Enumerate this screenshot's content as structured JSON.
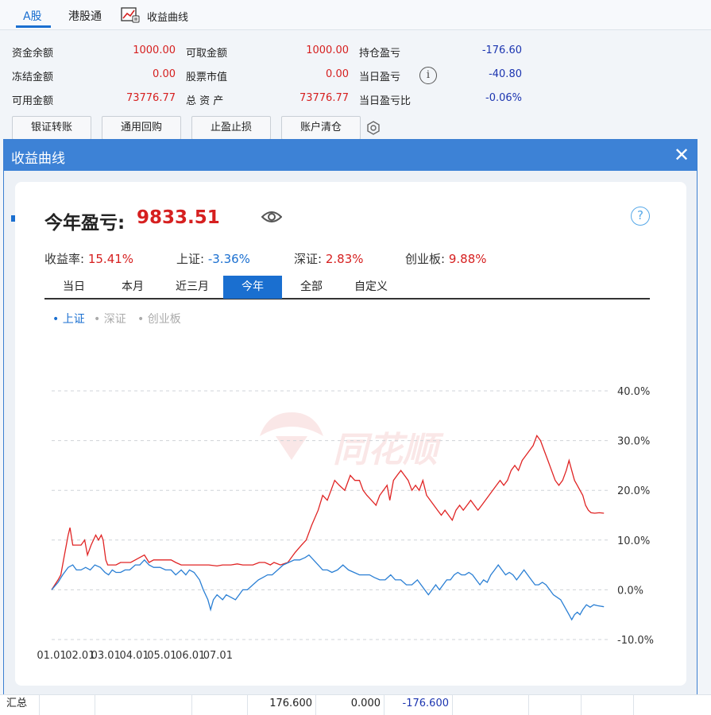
{
  "top_tabs": [
    {
      "label": "A股",
      "active": true
    },
    {
      "label": "港股通",
      "active": false
    },
    {
      "label": "收益曲线",
      "icon": "line-chart-icon",
      "active": false
    }
  ],
  "account": {
    "fund_balance_label": "资金余额",
    "fund_balance": "1000.00",
    "frozen_label": "冻结金额",
    "frozen": "0.00",
    "available_label": "可用金额",
    "available": "73776.77",
    "withdrawable_label": "可取金额",
    "withdrawable": "1000.00",
    "stock_value_label": "股票市值",
    "stock_value": "0.00",
    "total_assets_label": "总 资 产",
    "total_assets": "73776.77",
    "position_pnl_label": "持仓盈亏",
    "position_pnl": "-176.60",
    "daily_pnl_label": "当日盈亏",
    "daily_pnl": "-40.80",
    "daily_pnl_ratio_label": "当日盈亏比",
    "daily_pnl_ratio": "-0.06%"
  },
  "action_buttons": [
    "银证转账",
    "通用回购",
    "止盈止损",
    "账户清仓"
  ],
  "modal": {
    "title": "收益曲线",
    "year_pnl_label": "今年盈亏:",
    "year_pnl_value": "9833.51",
    "stats": [
      {
        "key": "收益率:",
        "value": "15.41%",
        "color": "red"
      },
      {
        "key": "上证:",
        "value": "-3.36%",
        "color": "blue"
      },
      {
        "key": "深证:",
        "value": "2.83%",
        "color": "red"
      },
      {
        "key": "创业板:",
        "value": "9.88%",
        "color": "red"
      }
    ],
    "period_tabs": [
      "当日",
      "本月",
      "近三月",
      "今年",
      "全部",
      "自定义"
    ],
    "active_period": "今年",
    "legends": [
      {
        "label": "上证",
        "active": true
      },
      {
        "label": "深证",
        "active": false
      },
      {
        "label": "创业板",
        "active": false
      }
    ],
    "watermark": "同花顺"
  },
  "chart_data": {
    "type": "line",
    "x_ticks": [
      "01.01",
      "02.01",
      "03.01",
      "04.01",
      "05.01",
      "06.01",
      "07.01"
    ],
    "y_ticks": [
      "40.0%",
      "30.0%",
      "20.0%",
      "10.0%",
      "0.0%",
      "-10.0%"
    ],
    "ylim": [
      -10,
      40
    ],
    "grid": true,
    "colors": {
      "portfolio": "#e02424",
      "index": "#2a7fd4"
    },
    "series": [
      {
        "key": "portfolio",
        "values": [
          [
            0,
            0
          ],
          [
            7,
            2
          ],
          [
            10,
            3
          ],
          [
            13,
            6
          ],
          [
            18,
            11
          ],
          [
            20,
            12.5
          ],
          [
            23,
            9
          ],
          [
            27,
            9
          ],
          [
            32,
            9
          ],
          [
            36,
            10
          ],
          [
            39,
            7
          ],
          [
            43,
            9
          ],
          [
            48,
            11
          ],
          [
            51,
            10
          ],
          [
            54,
            11
          ],
          [
            56,
            10
          ],
          [
            59,
            6
          ],
          [
            61,
            5
          ],
          [
            65,
            5
          ],
          [
            70,
            5
          ],
          [
            75,
            5.5
          ],
          [
            80,
            5.5
          ],
          [
            86,
            5.5
          ],
          [
            91,
            6
          ],
          [
            96,
            6.5
          ],
          [
            101,
            7
          ],
          [
            106,
            5.5
          ],
          [
            111,
            6
          ],
          [
            118,
            6
          ],
          [
            124,
            6
          ],
          [
            130,
            6
          ],
          [
            135,
            5.5
          ],
          [
            141,
            5
          ],
          [
            151,
            5
          ],
          [
            161,
            5
          ],
          [
            171,
            5
          ],
          [
            180,
            4.8
          ],
          [
            186,
            5
          ],
          [
            190,
            5
          ],
          [
            195,
            5
          ],
          [
            202,
            5.2
          ],
          [
            208,
            5
          ],
          [
            212,
            5
          ],
          [
            219,
            5
          ],
          [
            226,
            5.5
          ],
          [
            232,
            5.5
          ],
          [
            238,
            5
          ],
          [
            242,
            5.5
          ],
          [
            249,
            5
          ],
          [
            257,
            5.5
          ],
          [
            265,
            7.5
          ],
          [
            272,
            9
          ],
          [
            277,
            10
          ],
          [
            283,
            13
          ],
          [
            290,
            16
          ],
          [
            295,
            19
          ],
          [
            300,
            18
          ],
          [
            304,
            20
          ],
          [
            308,
            22
          ],
          [
            313,
            21
          ],
          [
            319,
            20
          ],
          [
            325,
            23
          ],
          [
            330,
            22
          ],
          [
            335,
            22
          ],
          [
            339,
            20
          ],
          [
            343,
            19
          ],
          [
            348,
            18
          ],
          [
            353,
            17
          ],
          [
            357,
            19
          ],
          [
            361,
            20
          ],
          [
            365,
            21
          ],
          [
            368,
            18
          ],
          [
            372,
            22
          ],
          [
            376,
            23
          ],
          [
            380,
            24
          ],
          [
            384,
            23
          ],
          [
            388,
            22
          ],
          [
            392,
            20
          ],
          [
            396,
            21
          ],
          [
            400,
            20
          ],
          [
            404,
            22
          ],
          [
            408,
            19
          ],
          [
            412,
            18
          ],
          [
            416,
            17
          ],
          [
            420,
            16
          ],
          [
            424,
            15
          ],
          [
            428,
            16
          ],
          [
            432,
            15
          ],
          [
            436,
            14
          ],
          [
            440,
            16
          ],
          [
            444,
            17
          ],
          [
            448,
            16
          ],
          [
            452,
            17
          ],
          [
            456,
            18
          ],
          [
            460,
            17
          ],
          [
            464,
            16
          ],
          [
            468,
            17
          ],
          [
            472,
            18
          ],
          [
            476,
            19
          ],
          [
            480,
            20
          ],
          [
            484,
            21
          ],
          [
            488,
            22
          ],
          [
            492,
            21
          ],
          [
            496,
            22
          ],
          [
            500,
            24
          ],
          [
            504,
            25
          ],
          [
            508,
            24
          ],
          [
            512,
            26
          ],
          [
            516,
            27
          ],
          [
            520,
            28
          ],
          [
            524,
            29
          ],
          [
            528,
            31
          ],
          [
            532,
            30
          ],
          [
            536,
            28
          ],
          [
            540,
            26
          ],
          [
            544,
            24
          ],
          [
            548,
            22
          ],
          [
            552,
            21
          ],
          [
            556,
            22
          ],
          [
            560,
            24
          ],
          [
            563,
            26
          ],
          [
            566,
            24
          ],
          [
            569,
            22
          ],
          [
            572,
            21
          ],
          [
            575,
            20
          ],
          [
            578,
            19
          ],
          [
            581,
            17
          ],
          [
            584,
            16
          ],
          [
            587,
            15.5
          ],
          [
            591,
            15.4
          ],
          [
            596,
            15.5
          ],
          [
            601,
            15.4
          ]
        ]
      },
      {
        "key": "index",
        "values": [
          [
            0,
            0
          ],
          [
            7,
            1.5
          ],
          [
            12,
            3
          ],
          [
            18,
            4.5
          ],
          [
            23,
            5
          ],
          [
            27,
            4
          ],
          [
            32,
            4
          ],
          [
            37,
            4.5
          ],
          [
            42,
            4
          ],
          [
            47,
            5
          ],
          [
            53,
            4.5
          ],
          [
            58,
            3.5
          ],
          [
            62,
            3
          ],
          [
            66,
            4
          ],
          [
            70,
            3.5
          ],
          [
            75,
            3.5
          ],
          [
            80,
            4
          ],
          [
            85,
            4
          ],
          [
            91,
            5
          ],
          [
            96,
            5
          ],
          [
            101,
            6
          ],
          [
            106,
            5
          ],
          [
            111,
            4.5
          ],
          [
            118,
            4.5
          ],
          [
            124,
            4
          ],
          [
            130,
            4
          ],
          [
            135,
            3
          ],
          [
            141,
            4
          ],
          [
            146,
            3
          ],
          [
            150,
            4
          ],
          [
            155,
            3.5
          ],
          [
            161,
            2
          ],
          [
            165,
            0
          ],
          [
            170,
            -2
          ],
          [
            173,
            -4
          ],
          [
            176,
            -2
          ],
          [
            180,
            -1
          ],
          [
            186,
            -2
          ],
          [
            190,
            -1
          ],
          [
            195,
            -1.5
          ],
          [
            200,
            -2
          ],
          [
            204,
            -1
          ],
          [
            208,
            0
          ],
          [
            213,
            0
          ],
          [
            219,
            1
          ],
          [
            225,
            2
          ],
          [
            230,
            2.5
          ],
          [
            235,
            3
          ],
          [
            240,
            3
          ],
          [
            246,
            4
          ],
          [
            252,
            5
          ],
          [
            258,
            5.5
          ],
          [
            264,
            6
          ],
          [
            270,
            6
          ],
          [
            276,
            6.5
          ],
          [
            280,
            7
          ],
          [
            285,
            6
          ],
          [
            290,
            5
          ],
          [
            295,
            4
          ],
          [
            300,
            4
          ],
          [
            305,
            3.5
          ],
          [
            311,
            4
          ],
          [
            317,
            5
          ],
          [
            323,
            4
          ],
          [
            329,
            3.5
          ],
          [
            335,
            3
          ],
          [
            341,
            3
          ],
          [
            346,
            3
          ],
          [
            351,
            2.5
          ],
          [
            357,
            2
          ],
          [
            363,
            2
          ],
          [
            369,
            3
          ],
          [
            374,
            2
          ],
          [
            380,
            2
          ],
          [
            386,
            1
          ],
          [
            392,
            1
          ],
          [
            398,
            2
          ],
          [
            402,
            1
          ],
          [
            406,
            0
          ],
          [
            410,
            -1
          ],
          [
            414,
            0
          ],
          [
            418,
            1
          ],
          [
            422,
            0
          ],
          [
            426,
            1
          ],
          [
            430,
            2
          ],
          [
            434,
            2
          ],
          [
            438,
            3
          ],
          [
            442,
            3.5
          ],
          [
            446,
            3
          ],
          [
            450,
            3
          ],
          [
            454,
            3.5
          ],
          [
            458,
            3
          ],
          [
            462,
            2
          ],
          [
            466,
            1
          ],
          [
            470,
            2
          ],
          [
            474,
            1.5
          ],
          [
            478,
            3
          ],
          [
            482,
            4
          ],
          [
            486,
            5
          ],
          [
            490,
            4
          ],
          [
            494,
            3
          ],
          [
            498,
            3.5
          ],
          [
            502,
            3
          ],
          [
            506,
            2
          ],
          [
            510,
            3
          ],
          [
            514,
            4
          ],
          [
            518,
            3
          ],
          [
            522,
            2
          ],
          [
            526,
            1
          ],
          [
            530,
            1
          ],
          [
            534,
            1.5
          ],
          [
            538,
            1
          ],
          [
            542,
            0
          ],
          [
            546,
            -1
          ],
          [
            550,
            -1.5
          ],
          [
            554,
            -2
          ],
          [
            557,
            -3
          ],
          [
            560,
            -4
          ],
          [
            563,
            -5
          ],
          [
            566,
            -6
          ],
          [
            569,
            -5
          ],
          [
            572,
            -4.5
          ],
          [
            575,
            -5
          ],
          [
            578,
            -4
          ],
          [
            582,
            -3
          ],
          [
            586,
            -3.5
          ],
          [
            590,
            -3
          ],
          [
            594,
            -3.2
          ],
          [
            601,
            -3.4
          ]
        ]
      }
    ]
  },
  "summary_row": {
    "label": "汇总",
    "col1": "176.600",
    "col2": "0.000",
    "col3": "-176.600"
  }
}
